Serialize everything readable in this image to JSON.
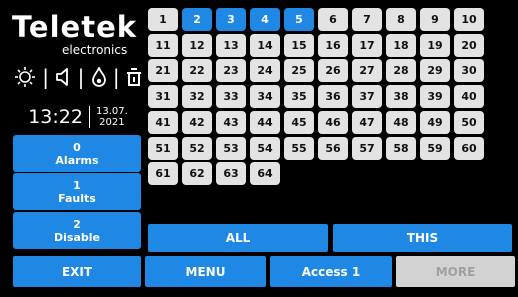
{
  "logo": {
    "brand": "Teletek",
    "sub": "electronics"
  },
  "status": {
    "time": "13:22",
    "date_line1": "13.07.",
    "date_line2": "2021"
  },
  "side_buttons": [
    {
      "count": "0",
      "label": "Alarms"
    },
    {
      "count": "1",
      "label": "Faults"
    },
    {
      "count": "2",
      "label": "Disable"
    }
  ],
  "zones": {
    "active": [
      2,
      3,
      4,
      5
    ],
    "labels": [
      "1",
      "2",
      "3",
      "4",
      "5",
      "6",
      "7",
      "8",
      "9",
      "10",
      "11",
      "12",
      "13",
      "14",
      "15",
      "16",
      "17",
      "18",
      "19",
      "20",
      "21",
      "22",
      "23",
      "24",
      "25",
      "26",
      "27",
      "28",
      "29",
      "30",
      "31",
      "32",
      "33",
      "34",
      "35",
      "36",
      "37",
      "38",
      "39",
      "40",
      "41",
      "42",
      "43",
      "44",
      "45",
      "46",
      "47",
      "48",
      "49",
      "50",
      "51",
      "52",
      "53",
      "54",
      "55",
      "56",
      "57",
      "58",
      "59",
      "60",
      "61",
      "62",
      "63",
      "64"
    ]
  },
  "actions": {
    "all": "ALL",
    "this": "THIS"
  },
  "bottom_bar": {
    "exit": "EXIT",
    "menu": "MENU",
    "access": "Access 1",
    "more": "MORE"
  },
  "colors": {
    "accent": "#1f88e5",
    "zone_idle": "#e3e3e3",
    "disabled": "#d2d2d2",
    "background": "#000000"
  }
}
